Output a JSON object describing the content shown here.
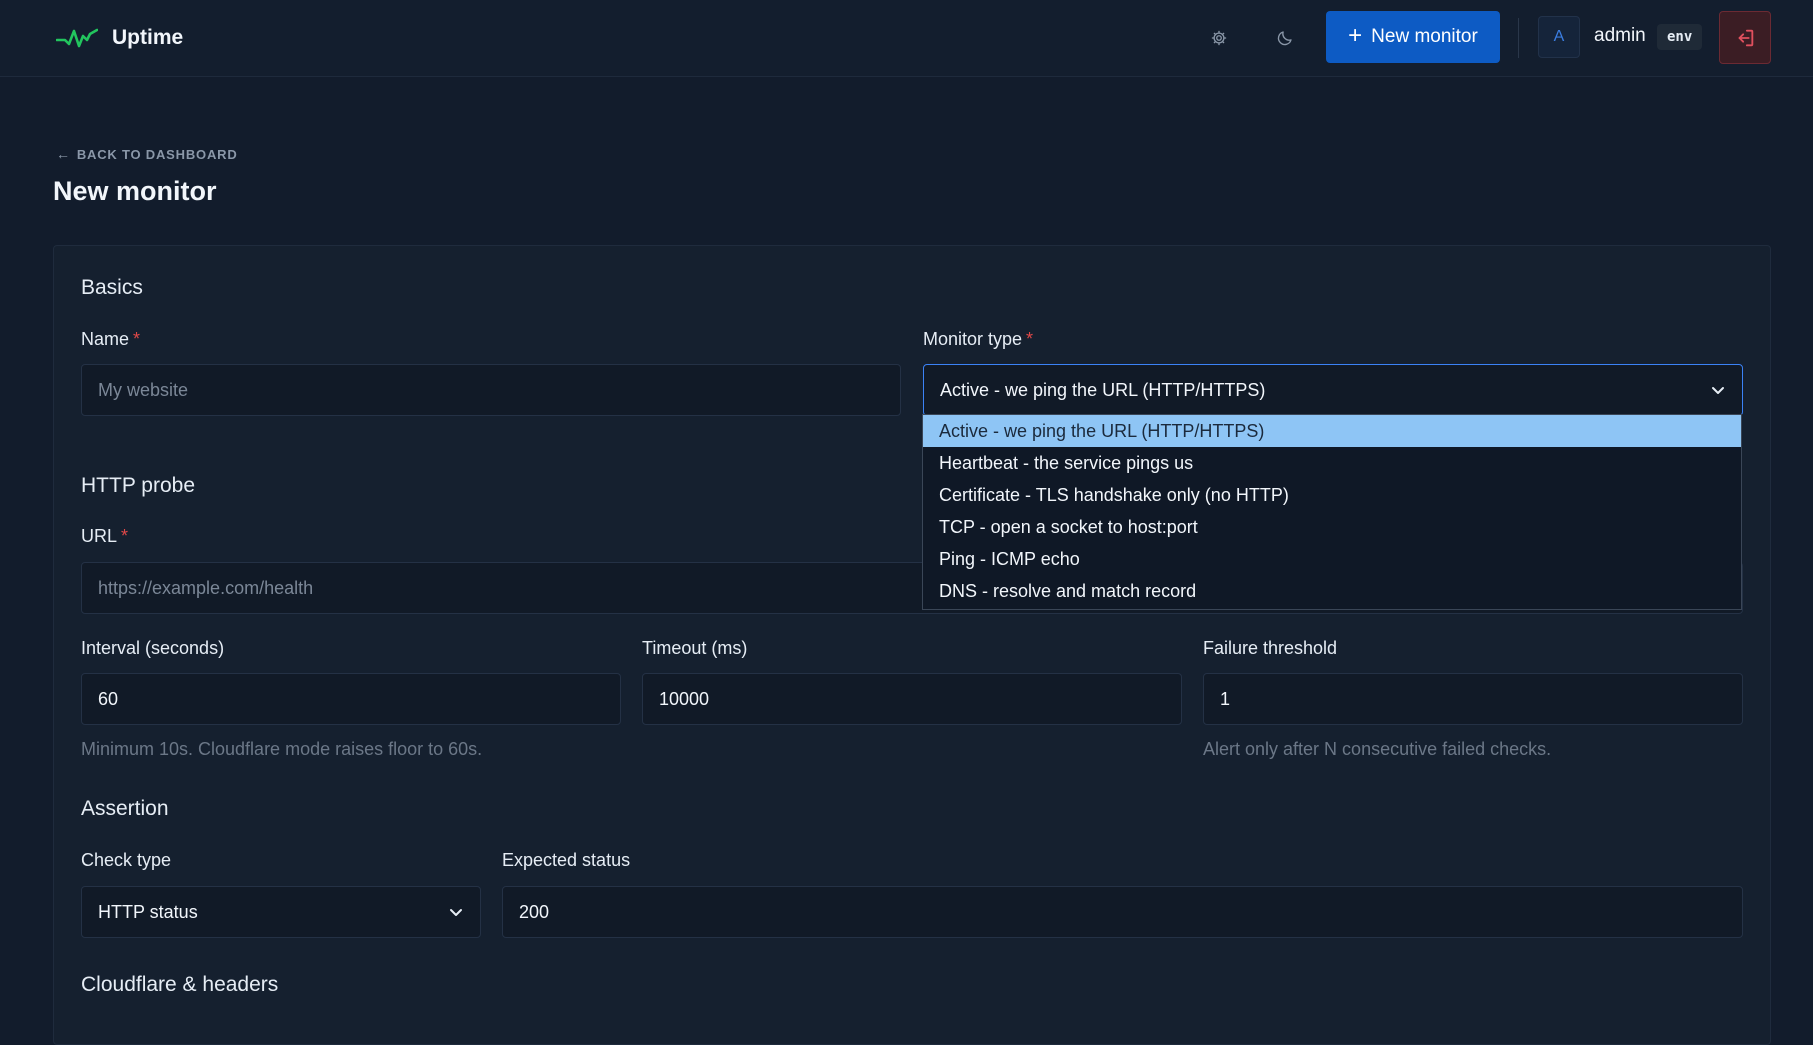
{
  "header": {
    "brand": "Uptime",
    "new_monitor_label": "New monitor",
    "avatar_letter": "A",
    "username": "admin",
    "env_badge": "env"
  },
  "page": {
    "back_label": "BACK TO DASHBOARD",
    "title": "New monitor"
  },
  "basics": {
    "section_title": "Basics",
    "name_label": "Name",
    "name_placeholder": "My website",
    "monitor_type_label": "Monitor type",
    "monitor_type_value": "Active - we ping the URL (HTTP/HTTPS)",
    "monitor_type_options": [
      "Active - we ping the URL (HTTP/HTTPS)",
      "Heartbeat - the service pings us",
      "Certificate - TLS handshake only (no HTTP)",
      "TCP - open a socket to host:port",
      "Ping - ICMP echo",
      "DNS - resolve and match record"
    ]
  },
  "http_probe": {
    "section_title": "HTTP probe",
    "url_label": "URL",
    "url_placeholder": "https://example.com/health",
    "interval_label": "Interval (seconds)",
    "interval_value": "60",
    "interval_hint": "Minimum 10s. Cloudflare mode raises floor to 60s.",
    "timeout_label": "Timeout (ms)",
    "timeout_value": "10000",
    "failure_label": "Failure threshold",
    "failure_value": "1",
    "failure_hint": "Alert only after N consecutive failed checks."
  },
  "assertion": {
    "section_title": "Assertion",
    "check_type_label": "Check type",
    "check_type_value": "HTTP status",
    "expected_status_label": "Expected status",
    "expected_status_value": "200"
  },
  "cloudflare": {
    "section_title": "Cloudflare & headers"
  },
  "colors": {
    "accent": "#0d5bc4",
    "brand_pulse": "#22c55e",
    "required": "#e04848",
    "selected_option": "#8ec5f5",
    "logout": "#e0505e"
  },
  "icons": {
    "brand": "pulse-icon",
    "settings": "gear-icon",
    "theme": "moon-icon",
    "logout": "logout-icon"
  }
}
